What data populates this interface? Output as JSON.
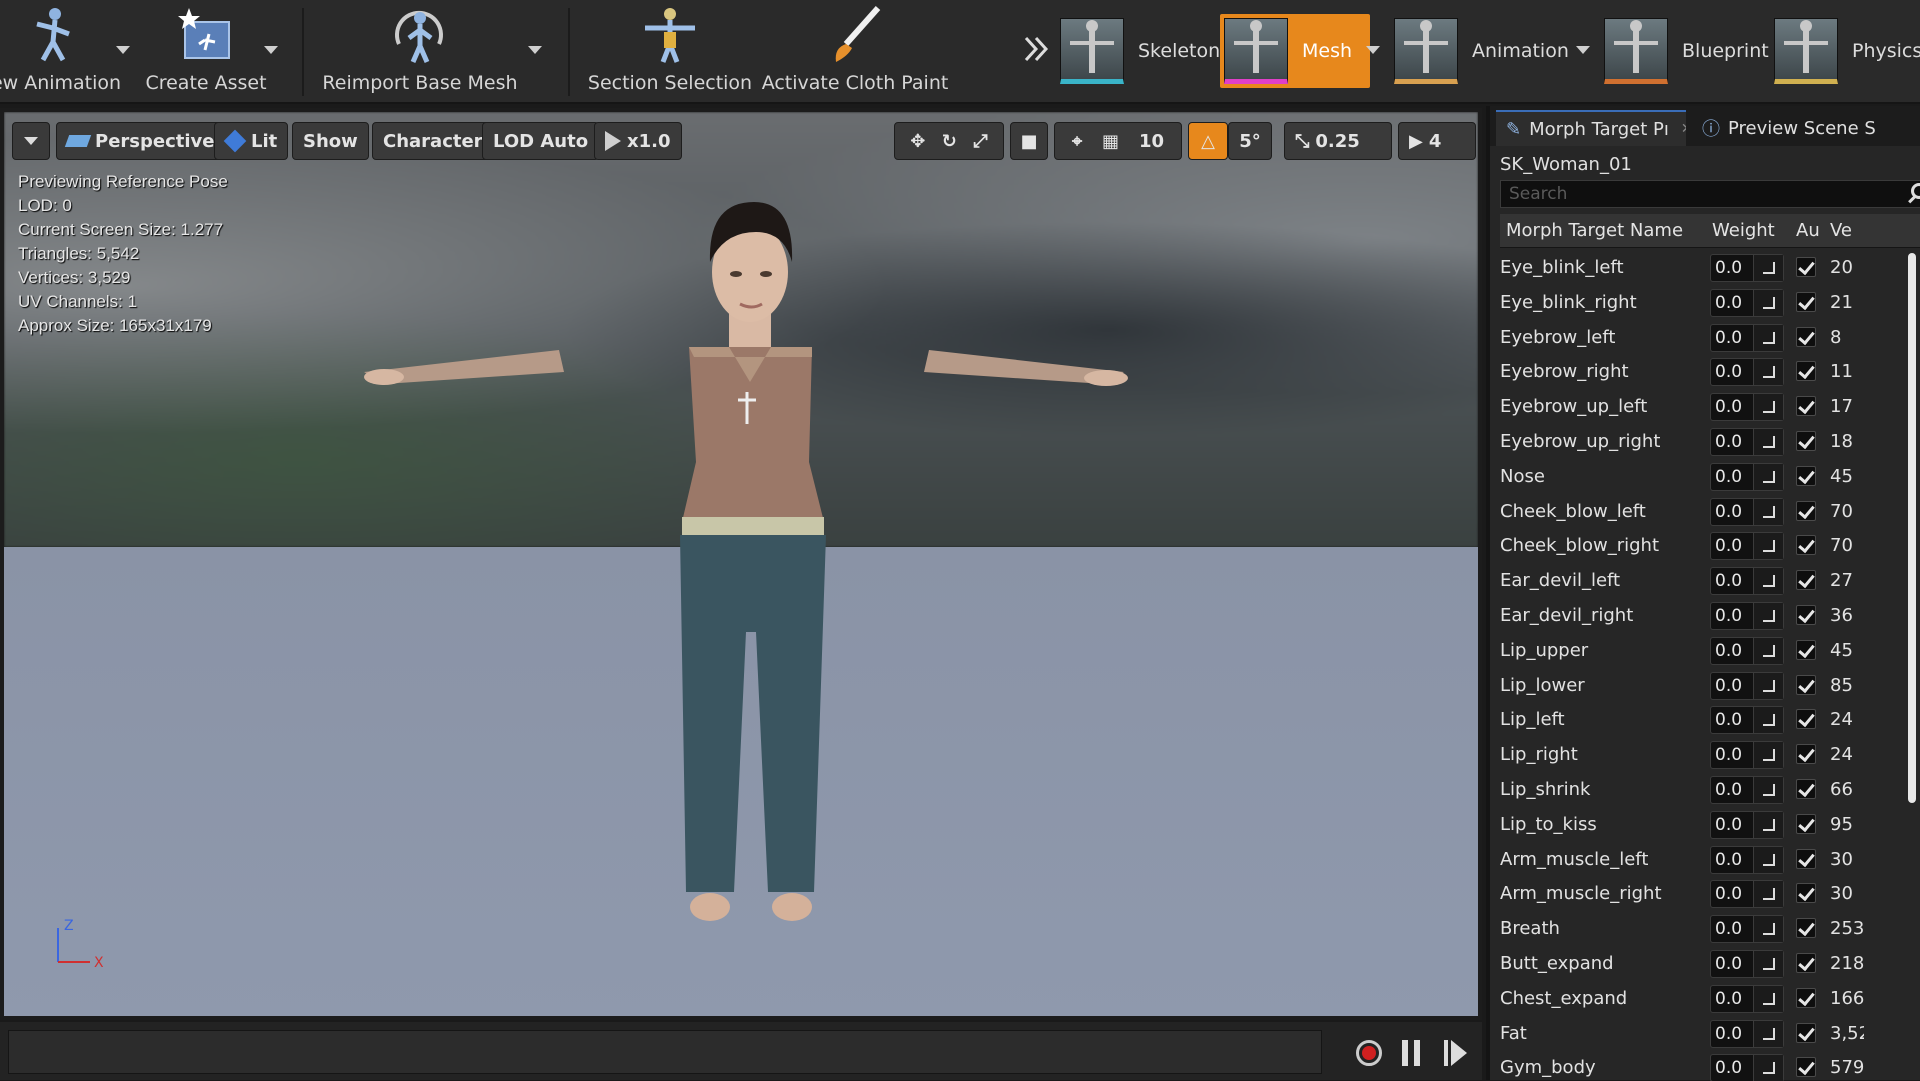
{
  "toolbar": {
    "buttons": [
      {
        "label": "ew Animation",
        "icon": "new-animation-icon"
      },
      {
        "label": "Create Asset",
        "icon": "create-asset-icon"
      },
      {
        "label": "Reimport Base Mesh",
        "icon": "reimport-icon"
      },
      {
        "label": "Section Selection",
        "icon": "section-selection-icon"
      },
      {
        "label": "Activate Cloth Paint",
        "icon": "cloth-paint-icon"
      }
    ],
    "modes": [
      {
        "label": "Skeleton"
      },
      {
        "label": "Mesh"
      },
      {
        "label": "Animation"
      },
      {
        "label": "Blueprint"
      },
      {
        "label": "Physics"
      }
    ],
    "overflow_icon": "chevron-double-right-icon"
  },
  "viewport": {
    "perspective": "Perspective",
    "lit": "Lit",
    "show": "Show",
    "character": "Character",
    "lod": "LOD Auto",
    "speed": "x1.0",
    "grid_snap": "10",
    "rot_snap": "5°",
    "scale_snap": "0.25",
    "camera_speed": "4",
    "stats": [
      "Previewing Reference Pose",
      "LOD: 0",
      "Current Screen Size: 1.277",
      "Triangles: 5,542",
      "Vertices: 3,529",
      "UV Channels: 1",
      "Approx Size: 165x31x179"
    ],
    "axis": {
      "z": "Z",
      "x": "X"
    }
  },
  "panel": {
    "tabs": [
      {
        "label": "Morph Target Pı"
      },
      {
        "label": "Preview Scene S"
      }
    ],
    "asset_name": "SK_Woman_01",
    "search_placeholder": "Search",
    "columns": {
      "name": "Morph Target Name",
      "weight": "Weight",
      "auto": "Au",
      "verts": "Ve"
    },
    "rows": [
      {
        "name": "Eye_blink_left",
        "weight": "0.0",
        "verts": "20"
      },
      {
        "name": "Eye_blink_right",
        "weight": "0.0",
        "verts": "21"
      },
      {
        "name": "Eyebrow_left",
        "weight": "0.0",
        "verts": "8"
      },
      {
        "name": "Eyebrow_right",
        "weight": "0.0",
        "verts": "11"
      },
      {
        "name": "Eyebrow_up_left",
        "weight": "0.0",
        "verts": "17"
      },
      {
        "name": "Eyebrow_up_right",
        "weight": "0.0",
        "verts": "18"
      },
      {
        "name": "Nose",
        "weight": "0.0",
        "verts": "45"
      },
      {
        "name": "Cheek_blow_left",
        "weight": "0.0",
        "verts": "70"
      },
      {
        "name": "Cheek_blow_right",
        "weight": "0.0",
        "verts": "70"
      },
      {
        "name": "Ear_devil_left",
        "weight": "0.0",
        "verts": "27"
      },
      {
        "name": "Ear_devil_right",
        "weight": "0.0",
        "verts": "36"
      },
      {
        "name": "Lip_upper",
        "weight": "0.0",
        "verts": "45"
      },
      {
        "name": "Lip_lower",
        "weight": "0.0",
        "verts": "85"
      },
      {
        "name": "Lip_left",
        "weight": "0.0",
        "verts": "24"
      },
      {
        "name": "Lip_right",
        "weight": "0.0",
        "verts": "24"
      },
      {
        "name": "Lip_shrink",
        "weight": "0.0",
        "verts": "66"
      },
      {
        "name": "Lip_to_kiss",
        "weight": "0.0",
        "verts": "95"
      },
      {
        "name": "Arm_muscle_left",
        "weight": "0.0",
        "verts": "30"
      },
      {
        "name": "Arm_muscle_right",
        "weight": "0.0",
        "verts": "30"
      },
      {
        "name": "Breath",
        "weight": "0.0",
        "verts": "253"
      },
      {
        "name": "Butt_expand",
        "weight": "0.0",
        "verts": "218"
      },
      {
        "name": "Chest_expand",
        "weight": "0.0",
        "verts": "166"
      },
      {
        "name": "Fat",
        "weight": "0.0",
        "verts": "3,52"
      },
      {
        "name": "Gym_body",
        "weight": "0.0",
        "verts": "579"
      }
    ]
  },
  "colors": {
    "accent": "#e7881c",
    "panel_bg": "#262626",
    "ground": "#8f99ad"
  }
}
